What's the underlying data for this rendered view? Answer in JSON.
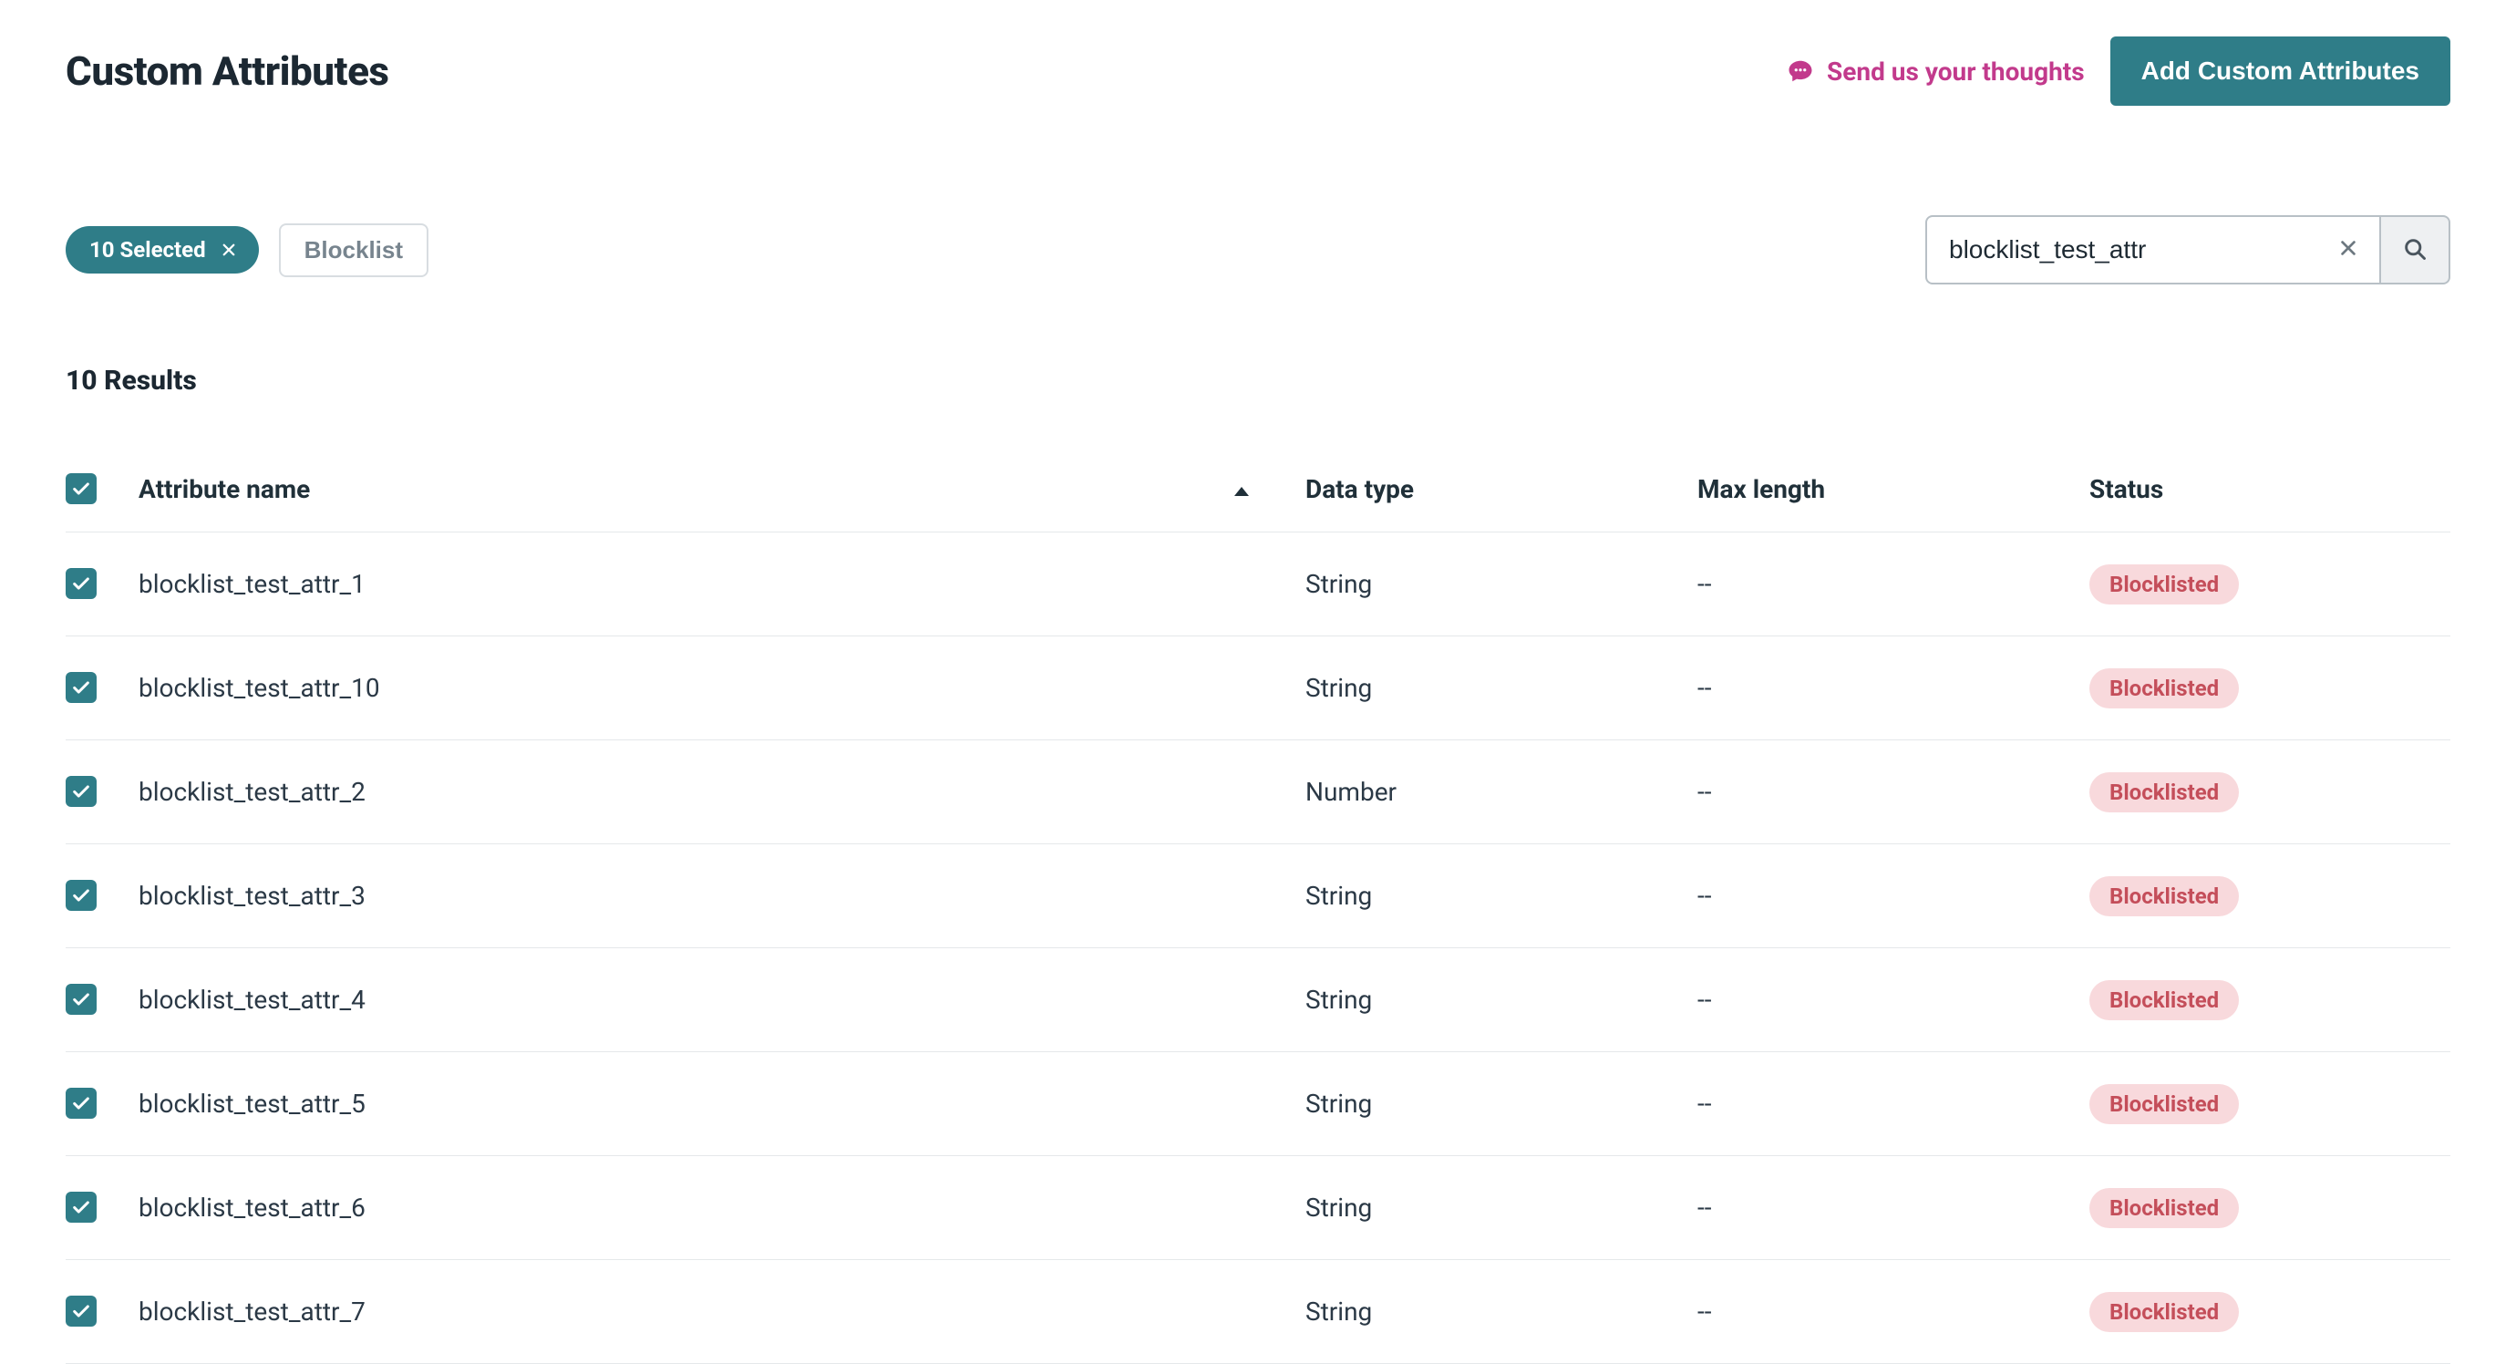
{
  "header": {
    "title": "Custom Attributes",
    "feedback_label": "Send us your thoughts",
    "add_button_label": "Add Custom Attributes"
  },
  "toolbar": {
    "selection_pill": "10 Selected",
    "blocklist_button": "Blocklist",
    "search_value": "blocklist_test_attr"
  },
  "results": {
    "label": "10 Results"
  },
  "table": {
    "columns": {
      "name": "Attribute name",
      "data_type": "Data type",
      "max_length": "Max length",
      "status": "Status"
    },
    "rows": [
      {
        "name": "blocklist_test_attr_1",
        "data_type": "String",
        "max_length": "--",
        "status": "Blocklisted"
      },
      {
        "name": "blocklist_test_attr_10",
        "data_type": "String",
        "max_length": "--",
        "status": "Blocklisted"
      },
      {
        "name": "blocklist_test_attr_2",
        "data_type": "Number",
        "max_length": "--",
        "status": "Blocklisted"
      },
      {
        "name": "blocklist_test_attr_3",
        "data_type": "String",
        "max_length": "--",
        "status": "Blocklisted"
      },
      {
        "name": "blocklist_test_attr_4",
        "data_type": "String",
        "max_length": "--",
        "status": "Blocklisted"
      },
      {
        "name": "blocklist_test_attr_5",
        "data_type": "String",
        "max_length": "--",
        "status": "Blocklisted"
      },
      {
        "name": "blocklist_test_attr_6",
        "data_type": "String",
        "max_length": "--",
        "status": "Blocklisted"
      },
      {
        "name": "blocklist_test_attr_7",
        "data_type": "String",
        "max_length": "--",
        "status": "Blocklisted"
      }
    ]
  }
}
